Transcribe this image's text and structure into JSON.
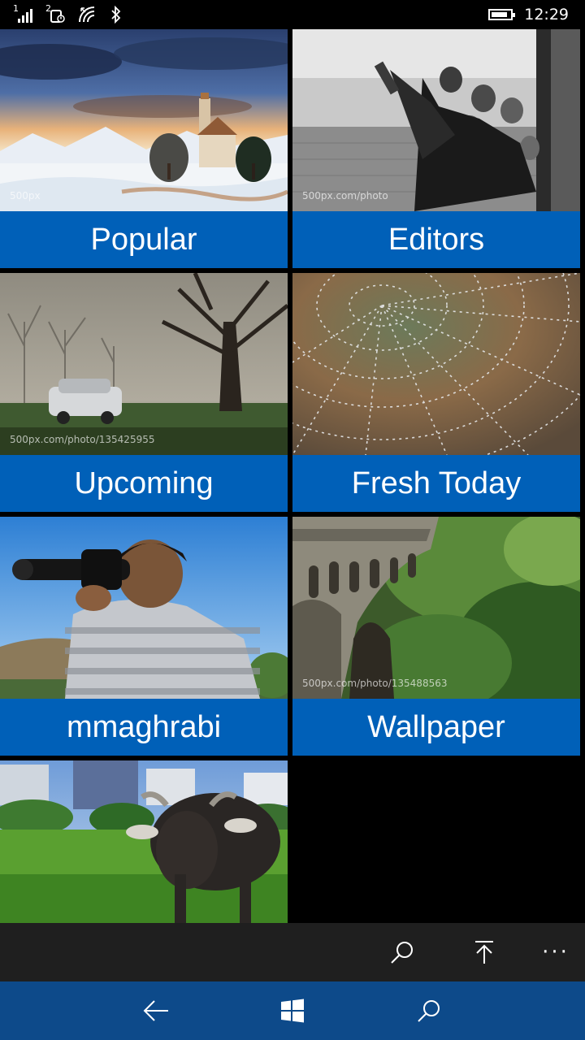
{
  "status_bar": {
    "sim1_label": "1",
    "sim2_label": "2",
    "time": "12:29",
    "battery_level": 0.85
  },
  "tiles": [
    {
      "label": "Popular",
      "watermark": "500px"
    },
    {
      "label": "Editors",
      "watermark": "500px.com/photo"
    },
    {
      "label": "Upcoming",
      "watermark": "500px.com/photo/135425955"
    },
    {
      "label": "Fresh Today",
      "watermark": ""
    },
    {
      "label": "mmaghrabi",
      "watermark": ""
    },
    {
      "label": "Wallpaper",
      "watermark": "500px.com/photo/135488563"
    },
    {
      "label": "",
      "watermark": ""
    }
  ],
  "app_bar": {
    "more_label": "···",
    "icons": [
      "search-icon",
      "scroll-to-top-icon",
      "more-icon"
    ]
  },
  "nav_bar": {
    "icons": [
      "back-arrow-icon",
      "windows-logo-icon",
      "cortana-search-icon"
    ]
  },
  "colors": {
    "tile_label_bg": "#0060b8",
    "app_bar_bg": "#1f1f1f",
    "nav_bar_bg": "#0d4a8a"
  }
}
